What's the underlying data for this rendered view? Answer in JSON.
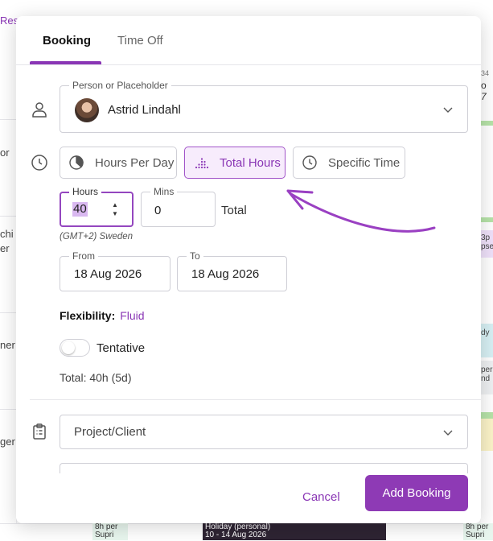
{
  "background": {
    "left_labels": [
      "Reso",
      "or",
      "chi",
      "er",
      "ner",
      "ger"
    ],
    "right_labels": [
      "34",
      "o",
      "7",
      "3p",
      "pse",
      "dy",
      "per",
      "nd"
    ],
    "bottom_cards": [
      {
        "lines": [
          "8h per",
          "Supri"
        ]
      },
      {
        "lines": [
          "Holiday (personal)",
          "10 - 14 Aug 2026"
        ]
      },
      {
        "lines": [
          "8h per",
          "Supri"
        ]
      }
    ]
  },
  "tabs": {
    "booking": "Booking",
    "time_off": "Time Off",
    "active": "Booking"
  },
  "person": {
    "label": "Person or Placeholder",
    "value": "Astrid Lindahl"
  },
  "mode": {
    "options": [
      "Hours Per Day",
      "Total Hours",
      "Specific Time"
    ],
    "selected": "Total Hours"
  },
  "duration": {
    "hours_label": "Hours",
    "hours_value": "40",
    "mins_label": "Mins",
    "mins_value": "0",
    "total_word": "Total",
    "timezone": "(GMT+2) Sweden"
  },
  "dates": {
    "from_label": "From",
    "from_value": "18 Aug 2026",
    "to_label": "To",
    "to_value": "18 Aug 2026"
  },
  "flexibility": {
    "label": "Flexibility:",
    "value": "Fluid"
  },
  "tentative": {
    "label": "Tentative",
    "enabled": false
  },
  "total_summary": "Total: 40h (5d)",
  "project": {
    "placeholder": "Project/Client"
  },
  "footer": {
    "cancel": "Cancel",
    "submit": "Add Booking"
  },
  "colors": {
    "accent": "#8e3ab5",
    "accent_light": "#f7ecfc",
    "selection": "#d9b8f0"
  }
}
